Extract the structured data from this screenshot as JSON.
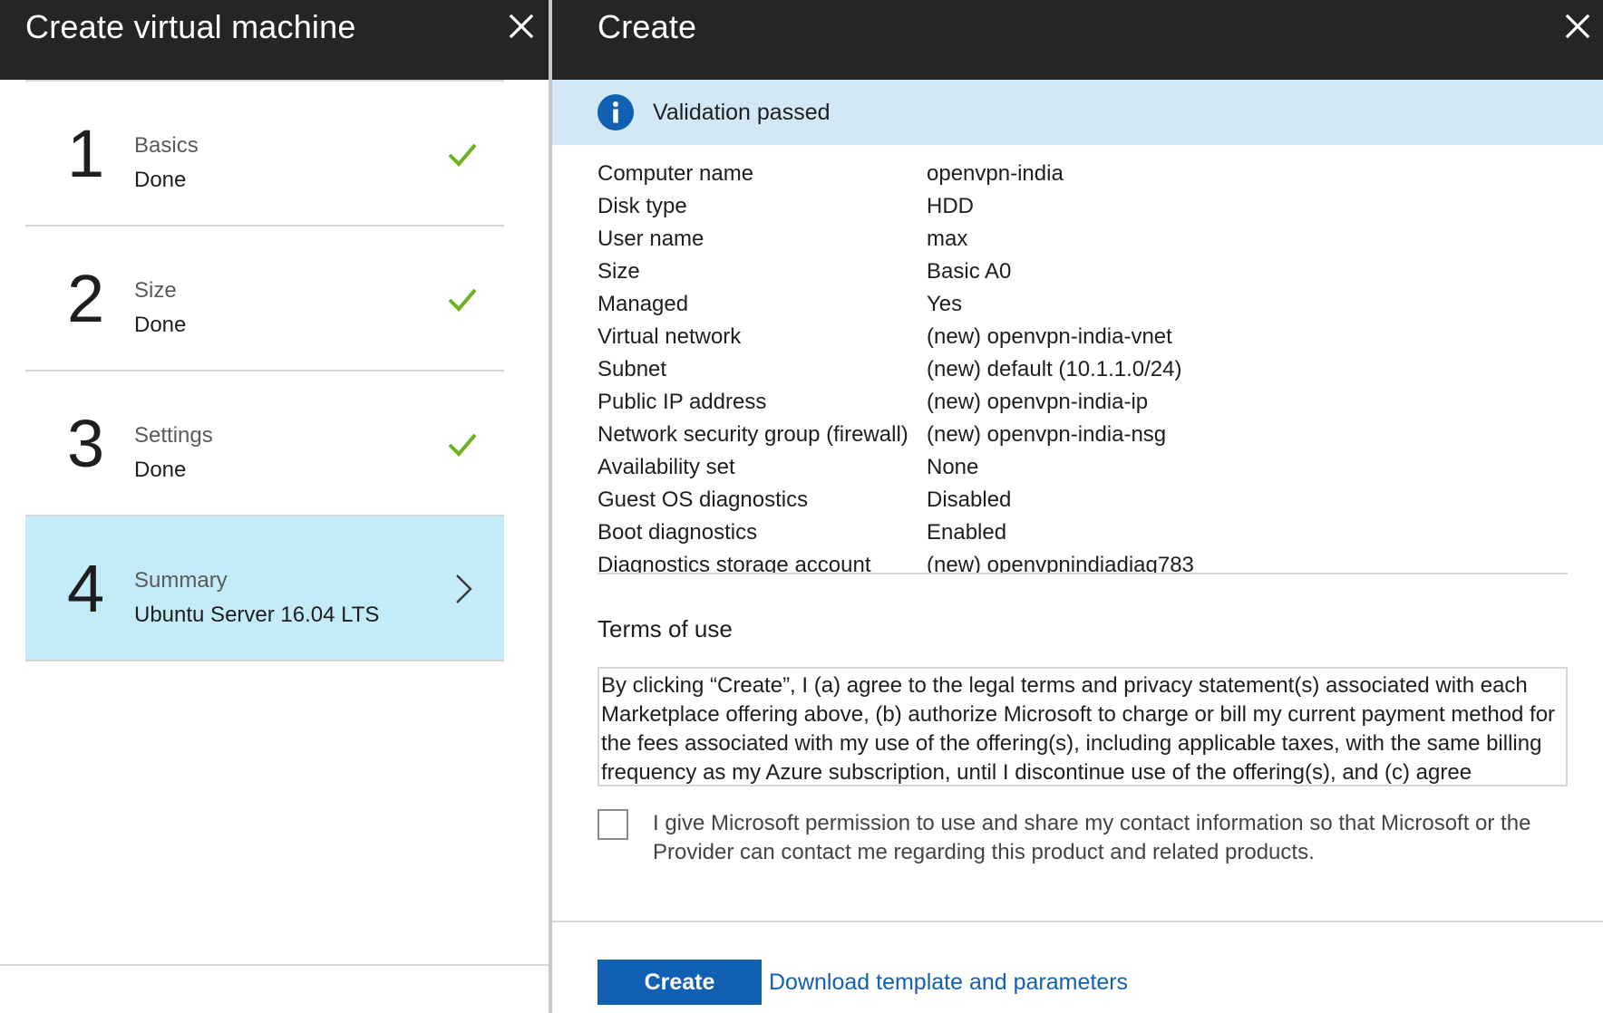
{
  "left_blade": {
    "title": "Create virtual machine",
    "steps": [
      {
        "number": "1",
        "title": "Basics",
        "subtitle": "Done",
        "status": "done"
      },
      {
        "number": "2",
        "title": "Size",
        "subtitle": "Done",
        "status": "done"
      },
      {
        "number": "3",
        "title": "Settings",
        "subtitle": "Done",
        "status": "done"
      },
      {
        "number": "4",
        "title": "Summary",
        "subtitle": "Ubuntu Server 16.04 LTS",
        "status": "active"
      }
    ]
  },
  "right_blade": {
    "title": "Create",
    "validation_text": "Validation passed",
    "summary": [
      {
        "label": "Computer name",
        "value": "openvpn-india"
      },
      {
        "label": "Disk type",
        "value": "HDD"
      },
      {
        "label": "User name",
        "value": "max"
      },
      {
        "label": "Size",
        "value": "Basic A0"
      },
      {
        "label": "Managed",
        "value": "Yes"
      },
      {
        "label": "Virtual network",
        "value": "(new) openvpn-india-vnet"
      },
      {
        "label": "Subnet",
        "value": "(new) default (10.1.1.0/24)"
      },
      {
        "label": "Public IP address",
        "value": "(new) openvpn-india-ip"
      },
      {
        "label": "Network security group (firewall)",
        "value": "(new) openvpn-india-nsg"
      },
      {
        "label": "Availability set",
        "value": "None"
      },
      {
        "label": "Guest OS diagnostics",
        "value": "Disabled"
      },
      {
        "label": "Boot diagnostics",
        "value": "Enabled"
      },
      {
        "label": "Diagnostics storage account",
        "value": "(new) openvpnindiadiag783"
      }
    ],
    "terms_heading": "Terms of use",
    "terms_text": "By clicking “Create”, I (a) agree to the legal terms and privacy statement(s) associated with each Marketplace offering above, (b) authorize Microsoft to charge or bill my current payment method for the fees associated with my use of the offering(s), including applicable taxes, with the same billing frequency as my Azure subscription, until I discontinue use of the offering(s), and (c) agree",
    "consent_text": "I give Microsoft permission to use and share my contact information so that Microsoft or the Provider can contact me regarding this product and related products.",
    "consent_checked": false,
    "create_label": "Create",
    "download_label": "Download template and parameters"
  },
  "colors": {
    "header_bg": "#252525",
    "active_step_bg": "#c4ebf8",
    "validation_bg": "#d3e8f7",
    "primary_blue": "#1160b2",
    "check_green": "#6bb122"
  },
  "icons": {
    "close": "close-icon",
    "check": "checkmark-icon",
    "chevron": "chevron-right-icon",
    "info": "info-icon"
  }
}
